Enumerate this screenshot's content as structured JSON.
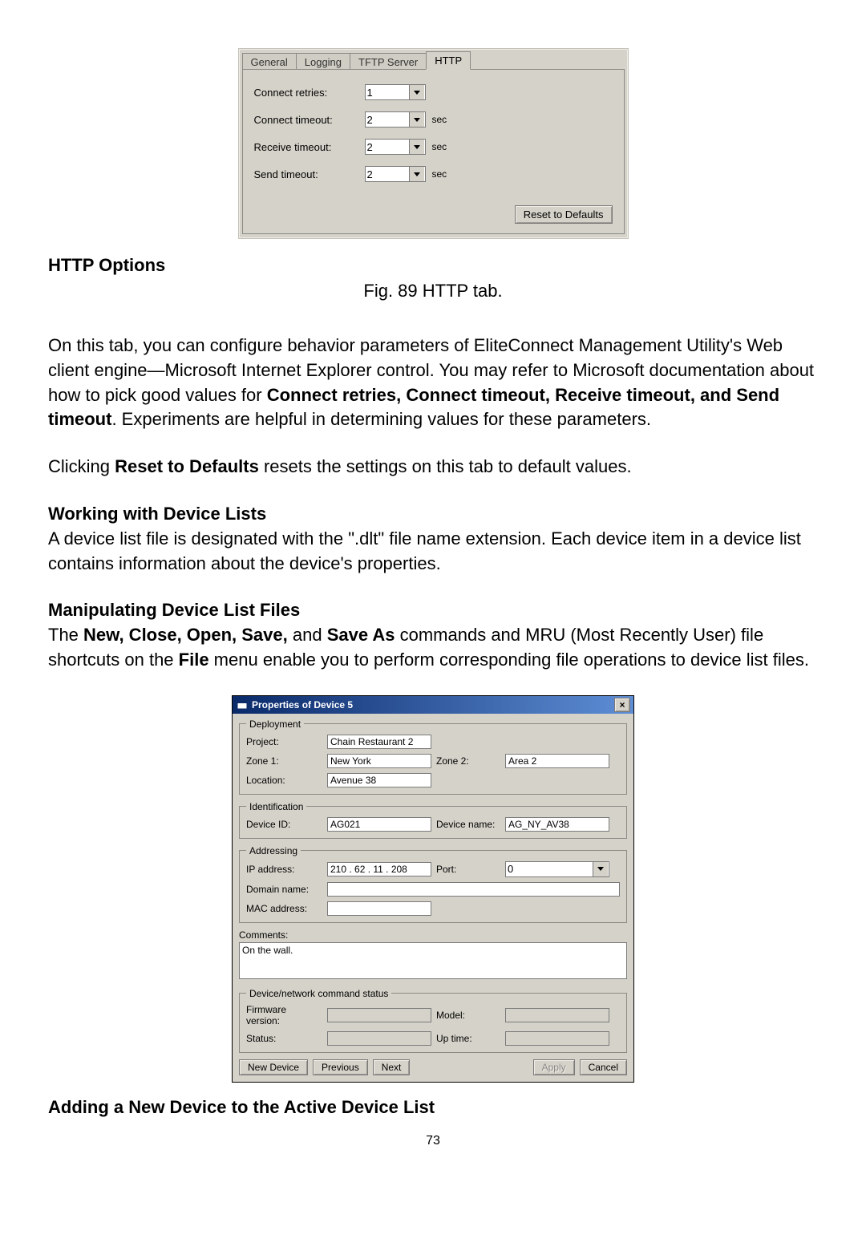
{
  "http_tab": {
    "tabs": [
      "General",
      "Logging",
      "TFTP Server",
      "HTTP"
    ],
    "active_tab": 3,
    "rows": {
      "connect_retries": {
        "label": "Connect retries:",
        "value": "1",
        "unit": ""
      },
      "connect_timeout": {
        "label": "Connect timeout:",
        "value": "2",
        "unit": "sec"
      },
      "receive_timeout": {
        "label": "Receive timeout:",
        "value": "2",
        "unit": "sec"
      },
      "send_timeout": {
        "label": "Send timeout:",
        "value": "2",
        "unit": "sec"
      }
    },
    "reset_button": "Reset to Defaults"
  },
  "headings": {
    "http_options": "HTTP Options",
    "fig_caption": "Fig. 89 HTTP tab.",
    "working_with": "Working with Device Lists",
    "manipulating": "Manipulating Device List Files",
    "adding_new": "Adding a New Device to the Active Device List"
  },
  "text": {
    "para1_a": "On this tab, you can configure behavior parameters of EliteConnect Management Utility's Web client engine—Microsoft Internet Explorer control. You may refer to Microsoft documentation about how to pick good values for ",
    "para1_b": "Connect retries, Connect timeout, Receive timeout, and Send timeout",
    "para1_c": ". Experiments are helpful in determining values for these parameters.",
    "para2_a": "Clicking ",
    "para2_b": "Reset to Defaults",
    "para2_c": " resets the settings on this tab to default values.",
    "para3": "A device list file is designated with the \".dlt\" file name extension. Each device item in a device list contains information about the device's properties.",
    "para4_a": "The ",
    "para4_b": "New, Close, Open, Save,",
    "para4_c": " and ",
    "para4_d": "Save As",
    "para4_e": " commands and MRU (Most Recently User) file shortcuts on the ",
    "para4_f": "File",
    "para4_g": " menu enable you to perform corresponding file operations to device list files."
  },
  "properties_dialog": {
    "title": "Properties of Device 5",
    "close_x": "×",
    "groups": {
      "deployment": {
        "legend": "Deployment",
        "project_label": "Project:",
        "project_value": "Chain Restaurant 2",
        "zone1_label": "Zone 1:",
        "zone1_value": "New York",
        "zone2_label": "Zone 2:",
        "zone2_value": "Area 2",
        "location_label": "Location:",
        "location_value": "Avenue 38"
      },
      "identification": {
        "legend": "Identification",
        "device_id_label": "Device ID:",
        "device_id_value": "AG021",
        "device_name_label": "Device name:",
        "device_name_value": "AG_NY_AV38"
      },
      "addressing": {
        "legend": "Addressing",
        "ip_label": "IP address:",
        "ip_value": "210 . 62 . 11 . 208",
        "port_label": "Port:",
        "port_value": "0",
        "domain_label": "Domain name:",
        "domain_value": "",
        "mac_label": "MAC address:",
        "mac_value": ""
      },
      "status": {
        "legend": "Device/network command status",
        "fw_label": "Firmware version:",
        "fw_value": "",
        "model_label": "Model:",
        "model_value": "",
        "status_label": "Status:",
        "status_value": "",
        "uptime_label": "Up time:",
        "uptime_value": ""
      }
    },
    "comments_label": "Comments:",
    "comments_value": "On the wall.",
    "buttons": {
      "new_device": "New Device",
      "previous": "Previous",
      "next": "Next",
      "apply": "Apply",
      "cancel": "Cancel"
    }
  },
  "page_number": "73"
}
